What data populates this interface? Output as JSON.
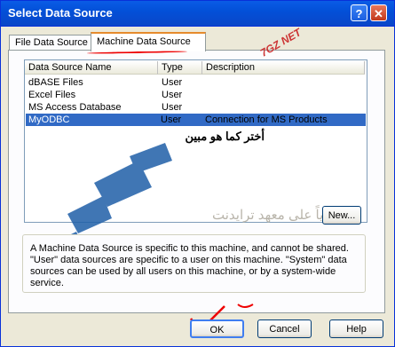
{
  "window": {
    "title": "Select Data Source",
    "help_glyph": "?",
    "close_glyph": "✕"
  },
  "tabs": [
    {
      "label": "File Data Source"
    },
    {
      "label": "Machine Data Source"
    }
  ],
  "table": {
    "headers": [
      "Data Source Name",
      "Type",
      "Description"
    ],
    "rows": [
      {
        "name": "dBASE Files",
        "type": "User",
        "desc": ""
      },
      {
        "name": "Excel Files",
        "type": "User",
        "desc": ""
      },
      {
        "name": "MS Access Database",
        "type": "User",
        "desc": ""
      },
      {
        "name": "MyODBC",
        "type": "User",
        "desc": "Connection for MS Products"
      }
    ]
  },
  "annotation": "أختر كما هو مبين",
  "watermark": {
    "arabic": "حصرياً على معهد ترايدنت",
    "site": "7GZ NET"
  },
  "buttons": {
    "new": "New...",
    "ok": "OK",
    "cancel": "Cancel",
    "help": "Help"
  },
  "info_text": "A Machine Data Source is specific to this machine, and cannot be shared. \"User\" data sources are specific to a user on this machine.  \"System\" data sources can be used by all users on this machine, or by a system-wide service.",
  "colors": {
    "selection": "#316ac5",
    "title_bar": "#0a5ce6",
    "annotation_red": "#e00000",
    "logo_blue": "#1f5fa8"
  }
}
